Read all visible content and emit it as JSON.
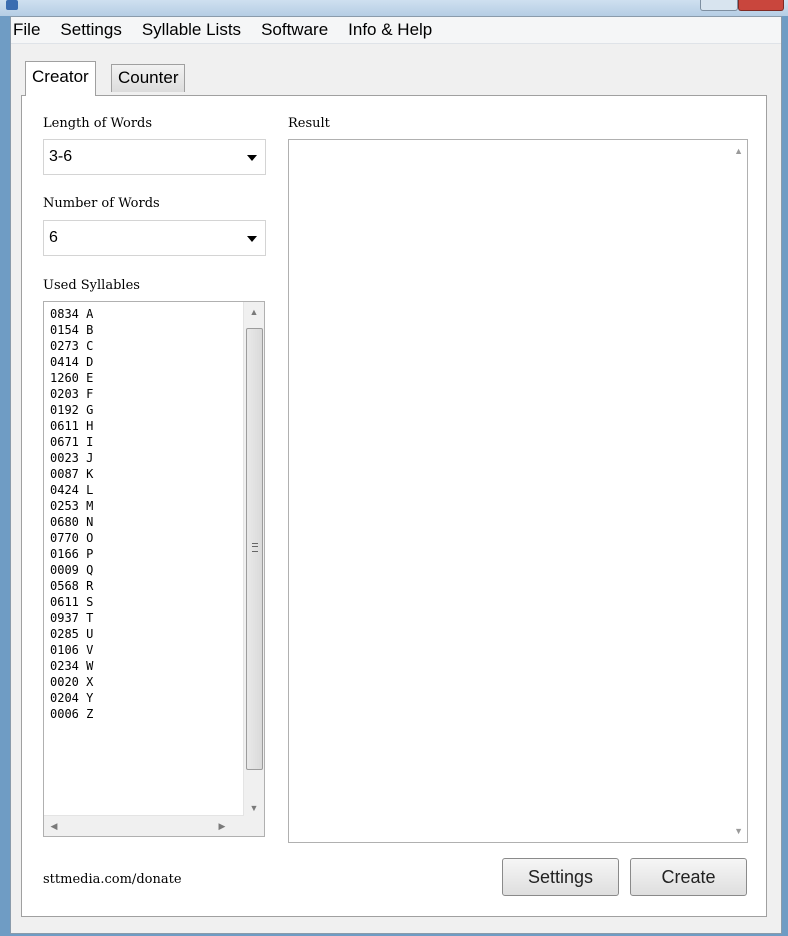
{
  "menu": {
    "file": "File",
    "settings": "Settings",
    "syllable_lists": "Syllable Lists",
    "software": "Software",
    "info_help": "Info & Help"
  },
  "tabs": {
    "creator": "Creator",
    "counter": "Counter"
  },
  "creator": {
    "length_label": "Length of Words",
    "length_value": "3-6",
    "number_label": "Number of Words",
    "number_value": "6",
    "syllables_label": "Used Syllables",
    "syllables": [
      "0834 A",
      "0154 B",
      "0273 C",
      "0414 D",
      "1260 E",
      "0203 F",
      "0192 G",
      "0611 H",
      "0671 I",
      "0023 J",
      "0087 K",
      "0424 L",
      "0253 M",
      "0680 N",
      "0770 O",
      "0166 P",
      "0009 Q",
      "0568 R",
      "0611 S",
      "0937 T",
      "0285 U",
      "0106 V",
      "0234 W",
      "0020 X",
      "0204 Y",
      "0006 Z"
    ],
    "result_label": "Result",
    "donate": "sttmedia.com/donate",
    "settings_button": "Settings",
    "create_button": "Create"
  },
  "icons": {
    "scroll_up": "triangle-up",
    "scroll_down": "triangle-down",
    "scroll_left": "triangle-left",
    "scroll_right": "triangle-right",
    "dropdown": "chevron-down"
  }
}
